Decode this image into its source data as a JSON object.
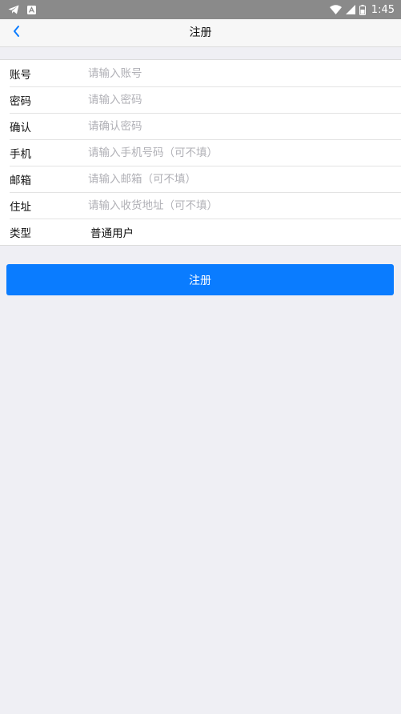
{
  "status_bar": {
    "time": "1:45",
    "icons": [
      "telegram-icon",
      "notification-a-icon",
      "wifi-icon",
      "cell-signal-icon",
      "battery-icon"
    ]
  },
  "nav": {
    "title": "注册",
    "back_icon": "chevron-left-icon",
    "accent_color": "#0a7cff"
  },
  "form": {
    "rows": [
      {
        "label": "账号",
        "placeholder": "请输入账号",
        "value": ""
      },
      {
        "label": "密码",
        "placeholder": "请输入密码",
        "value": ""
      },
      {
        "label": "确认",
        "placeholder": "请确认密码",
        "value": ""
      },
      {
        "label": "手机",
        "placeholder": "请输入手机号码（可不填）",
        "value": ""
      },
      {
        "label": "邮箱",
        "placeholder": "请输入邮箱（可不填）",
        "value": ""
      },
      {
        "label": "住址",
        "placeholder": "请输入收货地址（可不填）",
        "value": ""
      }
    ],
    "type_row": {
      "label": "类型",
      "selected": "普通用户"
    }
  },
  "submit": {
    "label": "注册",
    "color": "#0a7cff"
  }
}
